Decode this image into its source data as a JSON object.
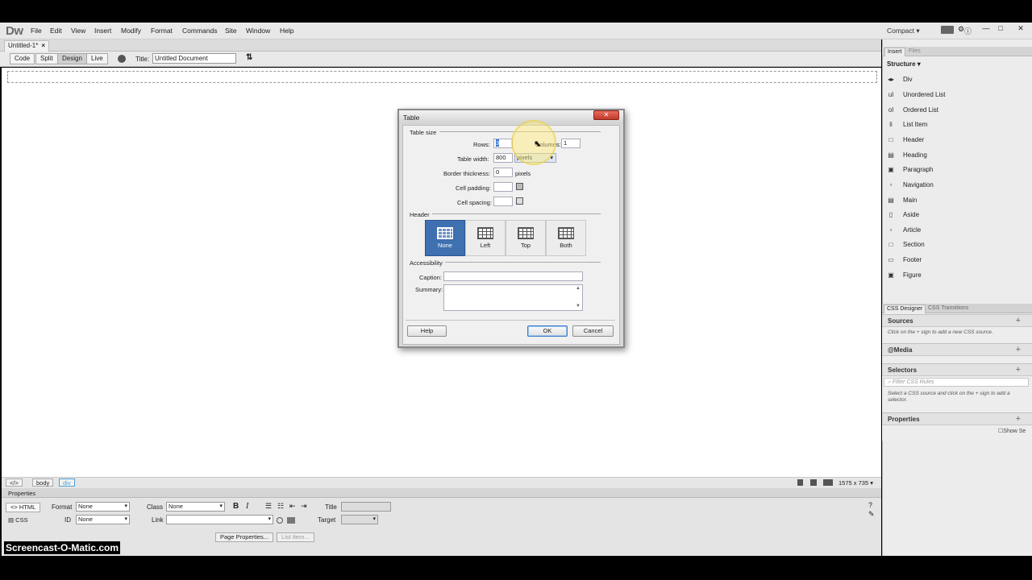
{
  "app": {
    "logo": "Dw",
    "workspace": "Compact ▾",
    "window_controls": [
      "—",
      "□",
      "✕"
    ]
  },
  "menu": {
    "items": [
      "File",
      "Edit",
      "View",
      "Insert",
      "Modify",
      "Format",
      "Commands",
      "Site",
      "Window",
      "Help"
    ]
  },
  "document": {
    "tab_label": "Untitled-1*",
    "tab_close": "×",
    "view_buttons": [
      "Code",
      "Split",
      "Design",
      "Live"
    ],
    "title_label": "Title:",
    "title_value": "Untitled Document"
  },
  "statusbar": {
    "tags": [
      "</>",
      "body",
      "div"
    ],
    "size": "1575 x 735 ▾"
  },
  "properties": {
    "header": "Properties",
    "html_btn": "<> HTML",
    "css_btn": "CSS",
    "format_label": "Format",
    "format_value": "None",
    "id_label": "ID",
    "id_value": "None",
    "class_label": "Class",
    "class_value": "None",
    "link_label": "Link",
    "link_value": "",
    "title_label": "Title",
    "target_label": "Target",
    "bold": "B",
    "italic": "I",
    "page_props_btn": "Page Properties...",
    "list_item_btn": "List Item..."
  },
  "insert_panel": {
    "tabs": [
      "Insert",
      "Files"
    ],
    "category": "Structure ▾",
    "items": [
      {
        "icon": "◂▸",
        "label": "Div"
      },
      {
        "icon": "ul",
        "label": "Unordered List"
      },
      {
        "icon": "ol",
        "label": "Ordered List"
      },
      {
        "icon": "li",
        "label": "List Item"
      },
      {
        "icon": "□",
        "label": "Header"
      },
      {
        "icon": "▤",
        "label": "Heading"
      },
      {
        "icon": "▣",
        "label": "Paragraph"
      },
      {
        "icon": "▫",
        "label": "Navigation"
      },
      {
        "icon": "▤",
        "label": "Main"
      },
      {
        "icon": "▯",
        "label": "Aside"
      },
      {
        "icon": "▫",
        "label": "Article"
      },
      {
        "icon": "□",
        "label": "Section"
      },
      {
        "icon": "▭",
        "label": "Footer"
      },
      {
        "icon": "▣",
        "label": "Figure"
      }
    ]
  },
  "css_designer": {
    "tabs": [
      "CSS Designer",
      "CSS Transitions"
    ],
    "sources": "Sources",
    "sources_note": "Click on the + sign to add a new CSS source.",
    "media": "@Media",
    "selectors": "Selectors",
    "filter_placeholder": "Filter CSS Rules",
    "selectors_note": "Select a CSS source and click on the + sign to add a selector.",
    "properties": "Properties",
    "show_set": "Show Se"
  },
  "dialog": {
    "title": "Table",
    "close": "✕",
    "table_size": "Table size",
    "rows_label": "Rows:",
    "rows_value": "3",
    "columns_label": "Columns:",
    "columns_value": "1",
    "width_label": "Table width:",
    "width_value": "800",
    "width_unit": "pixels",
    "border_label": "Border thickness:",
    "border_value": "0",
    "border_unit": "pixels",
    "padding_label": "Cell padding:",
    "spacing_label": "Cell spacing:",
    "header_section": "Header",
    "header_options": [
      "None",
      "Left",
      "Top",
      "Both"
    ],
    "accessibility": "Accessibility",
    "caption_label": "Caption:",
    "summary_label": "Summary:",
    "help": "Help",
    "ok": "OK",
    "cancel": "Cancel"
  },
  "watermark": "Screencast-O-Matic.com"
}
